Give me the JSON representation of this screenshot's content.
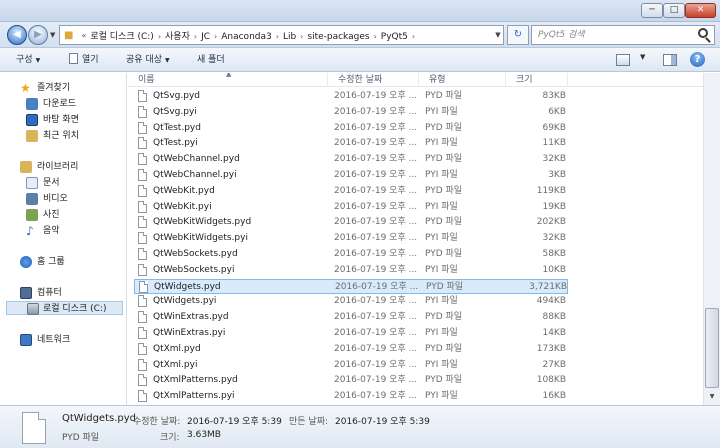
{
  "window": {
    "minimize": "─",
    "maximize": "□",
    "close": "✕"
  },
  "address": {
    "history_marker": "«",
    "crumbs": [
      "로컬 디스크 (C:)",
      "사용자",
      "JC",
      "Anaconda3",
      "Lib",
      "site-packages",
      "PyQt5"
    ],
    "separator": "›",
    "search_placeholder": "PyQt5 검색"
  },
  "toolbar": {
    "organize": "구성",
    "open": "열기",
    "share": "공유 대상",
    "new_folder": "새 폴더"
  },
  "nav": {
    "favorites": "즐겨찾기",
    "downloads": "다운로드",
    "desktop": "바탕 화면",
    "recent": "최근 위치",
    "libraries": "라이브러리",
    "documents": "문서",
    "videos": "비디오",
    "pictures": "사진",
    "music": "음악",
    "homegroup": "홈 그룹",
    "computer": "컴퓨터",
    "local_disk": "로컬 디스크 (C:)",
    "network": "네트워크"
  },
  "columns": {
    "name": "이름",
    "date": "수정한 날짜",
    "type": "유형",
    "size": "크기"
  },
  "files": [
    {
      "name": "QtSvg.pyd",
      "date": "2016-07-19 오후 ...",
      "type": "PYD 파일",
      "size": "83KB"
    },
    {
      "name": "QtSvg.pyi",
      "date": "2016-07-19 오후 ...",
      "type": "PYI 파일",
      "size": "6KB"
    },
    {
      "name": "QtTest.pyd",
      "date": "2016-07-19 오후 ...",
      "type": "PYD 파일",
      "size": "69KB"
    },
    {
      "name": "QtTest.pyi",
      "date": "2016-07-19 오후 ...",
      "type": "PYI 파일",
      "size": "11KB"
    },
    {
      "name": "QtWebChannel.pyd",
      "date": "2016-07-19 오후 ...",
      "type": "PYD 파일",
      "size": "32KB"
    },
    {
      "name": "QtWebChannel.pyi",
      "date": "2016-07-19 오후 ...",
      "type": "PYI 파일",
      "size": "3KB"
    },
    {
      "name": "QtWebKit.pyd",
      "date": "2016-07-19 오후 ...",
      "type": "PYD 파일",
      "size": "119KB"
    },
    {
      "name": "QtWebKit.pyi",
      "date": "2016-07-19 오후 ...",
      "type": "PYI 파일",
      "size": "19KB"
    },
    {
      "name": "QtWebKitWidgets.pyd",
      "date": "2016-07-19 오후 ...",
      "type": "PYD 파일",
      "size": "202KB"
    },
    {
      "name": "QtWebKitWidgets.pyi",
      "date": "2016-07-19 오후 ...",
      "type": "PYI 파일",
      "size": "32KB"
    },
    {
      "name": "QtWebSockets.pyd",
      "date": "2016-07-19 오후 ...",
      "type": "PYD 파일",
      "size": "58KB"
    },
    {
      "name": "QtWebSockets.pyi",
      "date": "2016-07-19 오후 ...",
      "type": "PYI 파일",
      "size": "10KB"
    },
    {
      "name": "QtWidgets.pyd",
      "date": "2016-07-19 오후 ...",
      "type": "PYD 파일",
      "size": "3,721KB",
      "selected": true
    },
    {
      "name": "QtWidgets.pyi",
      "date": "2016-07-19 오후 ...",
      "type": "PYI 파일",
      "size": "494KB"
    },
    {
      "name": "QtWinExtras.pyd",
      "date": "2016-07-19 오후 ...",
      "type": "PYD 파일",
      "size": "88KB"
    },
    {
      "name": "QtWinExtras.pyi",
      "date": "2016-07-19 오후 ...",
      "type": "PYI 파일",
      "size": "14KB"
    },
    {
      "name": "QtXml.pyd",
      "date": "2016-07-19 오후 ...",
      "type": "PYD 파일",
      "size": "173KB"
    },
    {
      "name": "QtXml.pyi",
      "date": "2016-07-19 오후 ...",
      "type": "PYI 파일",
      "size": "27KB"
    },
    {
      "name": "QtXmlPatterns.pyd",
      "date": "2016-07-19 오후 ...",
      "type": "PYD 파일",
      "size": "108KB"
    },
    {
      "name": "QtXmlPatterns.pyi",
      "date": "2016-07-19 오후 ...",
      "type": "PYI 파일",
      "size": "16KB"
    }
  ],
  "details": {
    "name": "QtWidgets.pyd",
    "type": "PYD 파일",
    "modified_label": "수정한 날짜:",
    "modified_value": "2016-07-19 오후 5:39",
    "created_label": "만든 날짜:",
    "created_value": "2016-07-19 오후 5:39",
    "size_label": "크기:",
    "size_value": "3.63MB"
  },
  "colors": {
    "selection": "#d9ebfb",
    "selection_border": "#84b8e8",
    "accent": "#2b6cc4"
  }
}
